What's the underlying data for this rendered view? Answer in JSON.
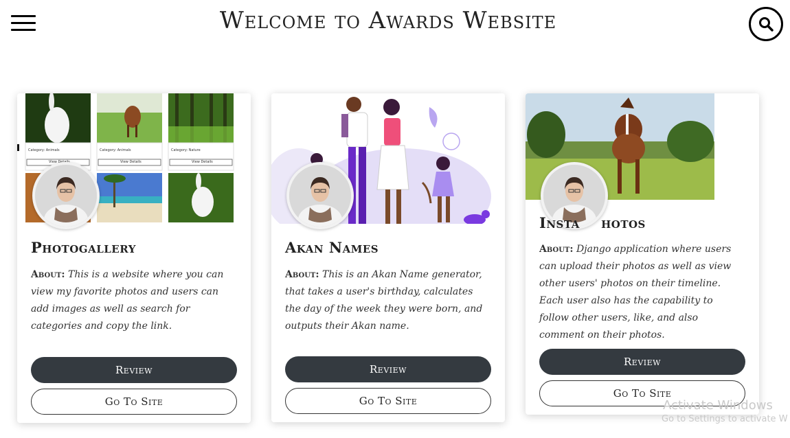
{
  "header": {
    "title": "Welcome to Awards Website",
    "menu_icon": "hamburger-icon",
    "search_icon": "search-icon"
  },
  "cards": [
    {
      "title": "Photogallery",
      "about_label": "About:",
      "description": "This is a website where you can view my favorite photos and users can add images as well as search for categories and copy the link.",
      "review_label": "Review",
      "site_label": "Go To Site",
      "thumbs": [
        {
          "category": "Category: Animals",
          "button": "View Details"
        },
        {
          "category": "Category: Animals",
          "button": "View Details"
        },
        {
          "category": "Category: Nature",
          "button": "View Details"
        }
      ]
    },
    {
      "title": "Akan Names",
      "about_label": "About:",
      "description": "This is an Akan Name generator, that takes a user's birthday, calculates the day of the week they were born, and outputs their Akan name.",
      "review_label": "Review",
      "site_label": "Go To Site"
    },
    {
      "title": "Instaphotos",
      "title_visible": "Insta    hotos",
      "about_label": "About:",
      "description": "Django application where users can upload their photos as well as view other users' photos on their timeline. Each user also has the capability to follow other users, like, and also comment on their photos.",
      "review_label": "Review",
      "site_label": "Go To Site"
    }
  ],
  "watermark": {
    "line1": "Activate Windows",
    "line2": "Go to Settings to activate W"
  },
  "colors": {
    "button_dark": "#343a40",
    "background": "#ffffff"
  }
}
